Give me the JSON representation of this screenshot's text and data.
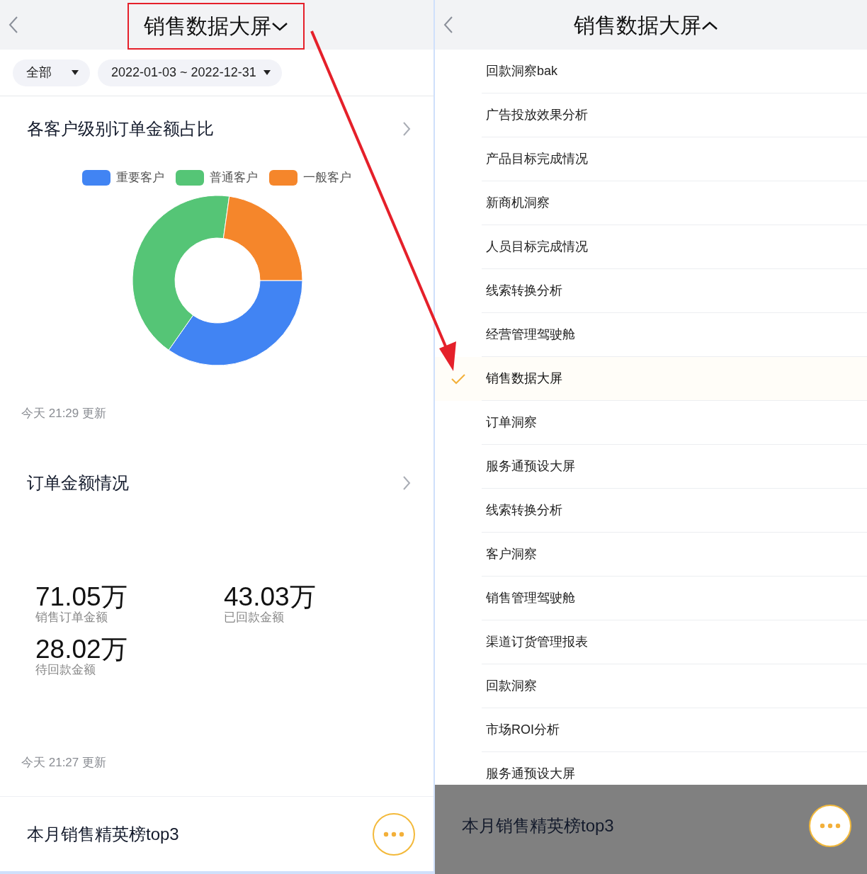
{
  "left_screen": {
    "header": {
      "title": "销售数据大屏",
      "expanded": false
    },
    "filters": [
      {
        "label": "全部"
      },
      {
        "label": "2022-01-03 ~ 2022-12-31"
      }
    ],
    "donut_card": {
      "title": "各客户级别订单金额占比",
      "legend": [
        {
          "label": "重要客户",
          "color": "#4184f3"
        },
        {
          "label": "普通客户",
          "color": "#55c576"
        },
        {
          "label": "一般客户",
          "color": "#f5862b"
        }
      ],
      "updated": "今天 21:29 更新"
    },
    "metrics_card": {
      "title": "订单金额情况",
      "metrics": [
        {
          "value": "71.05万",
          "label": "销售订单金额"
        },
        {
          "value": "43.03万",
          "label": "已回款金额"
        },
        {
          "value": "28.02万",
          "label": "待回款金额"
        }
      ],
      "updated": "今天 21:27 更新"
    },
    "bottom_card": {
      "title": "本月销售精英榜top3"
    }
  },
  "right_screen": {
    "header": {
      "title": "销售数据大屏",
      "expanded": true
    },
    "menu_items": [
      {
        "label": "回款洞察bak",
        "selected": false
      },
      {
        "label": "广告投放效果分析",
        "selected": false
      },
      {
        "label": "产品目标完成情况",
        "selected": false
      },
      {
        "label": "新商机洞察",
        "selected": false
      },
      {
        "label": "人员目标完成情况",
        "selected": false
      },
      {
        "label": "线索转换分析",
        "selected": false
      },
      {
        "label": "经营管理驾驶舱",
        "selected": false
      },
      {
        "label": "销售数据大屏",
        "selected": true
      },
      {
        "label": "订单洞察",
        "selected": false
      },
      {
        "label": "服务通预设大屏",
        "selected": false
      },
      {
        "label": "线索转换分析",
        "selected": false
      },
      {
        "label": "客户洞察",
        "selected": false
      },
      {
        "label": "销售管理驾驶舱",
        "selected": false
      },
      {
        "label": "渠道订货管理报表",
        "selected": false
      },
      {
        "label": "回款洞察",
        "selected": false
      },
      {
        "label": "市场ROI分析",
        "selected": false
      },
      {
        "label": "服务通预设大屏",
        "selected": false
      }
    ],
    "bottom_card": {
      "title": "本月销售精英榜top3"
    }
  }
}
